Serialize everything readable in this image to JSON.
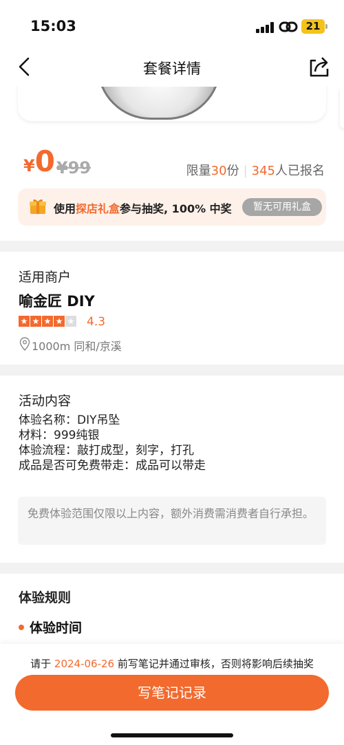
{
  "status_bar": {
    "time": "15:03",
    "battery": "21"
  },
  "nav": {
    "title": "套餐详情"
  },
  "price": {
    "currency": "¥",
    "current": "0",
    "original": "¥99",
    "quota_prefix": "限量",
    "quota_count": "30",
    "quota_suffix": "份",
    "signup_count": "345",
    "signup_suffix": "人已报名"
  },
  "gift": {
    "text_prefix": "使用",
    "highlight": "探店礼盒",
    "text_suffix": "参与抽奖, 100% 中奖",
    "button_label": "暂无可用礼盒"
  },
  "merchant": {
    "section_label": "适用商户",
    "name": "喻金匠 DIY",
    "rating": "4.3",
    "rating_value": 4.3,
    "distance_area": "1000m  同和/京溪"
  },
  "activity": {
    "section_label": "活动内容",
    "lines": [
      "体验名称：DIY吊坠",
      "材料：999纯银",
      "体验流程：敲打成型，刻字，打孔",
      "成品是否可免费带走：成品可以带走"
    ],
    "notice": "免费体验范围仅限以上内容，额外消费需消费者自行承担。"
  },
  "rules": {
    "section_label": "体验规则",
    "first_item": "体验时间"
  },
  "bottom": {
    "deadline_prefix": "请于 ",
    "deadline_date": "2024-06-26",
    "deadline_suffix": " 前写笔记并通过审核，否则将影响后续抽奖",
    "button_label": "写笔记记录"
  },
  "colors": {
    "accent": "#f26a2e",
    "gift_bg": "#fdf1ea"
  }
}
